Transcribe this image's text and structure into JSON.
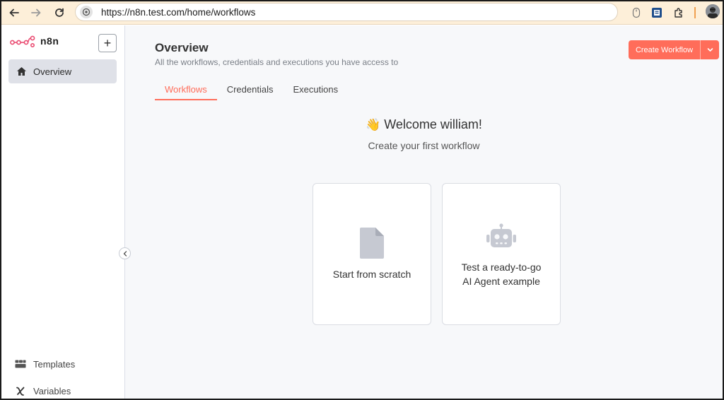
{
  "browser": {
    "url": "https://n8n.test.com/home/workflows"
  },
  "sidebar": {
    "logo_text": "n8n",
    "add_label": "+",
    "items": [
      {
        "label": "Overview",
        "icon": "home-icon"
      }
    ],
    "bottom_items": [
      {
        "label": "Templates",
        "icon": "templates-icon"
      },
      {
        "label": "Variables",
        "icon": "variables-icon"
      }
    ]
  },
  "main": {
    "title": "Overview",
    "subtitle": "All the workflows, credentials and executions you have access to",
    "create_button": "Create Workflow",
    "tabs": [
      {
        "label": "Workflows",
        "active": true
      },
      {
        "label": "Credentials",
        "active": false
      },
      {
        "label": "Executions",
        "active": false
      }
    ],
    "welcome_emoji": "👋",
    "welcome_text": "Welcome william!",
    "welcome_sub": "Create your first workflow",
    "cards": [
      {
        "label": "Start from scratch",
        "icon": "file-icon"
      },
      {
        "label_line1": "Test a ready-to-go",
        "label_line2": "AI Agent example",
        "icon": "robot-icon"
      }
    ]
  },
  "colors": {
    "accent": "#ff6d5a",
    "chrome": "#fdefd9",
    "sidebar_active": "#dfe1e8",
    "main_bg": "#f7f8fa"
  }
}
